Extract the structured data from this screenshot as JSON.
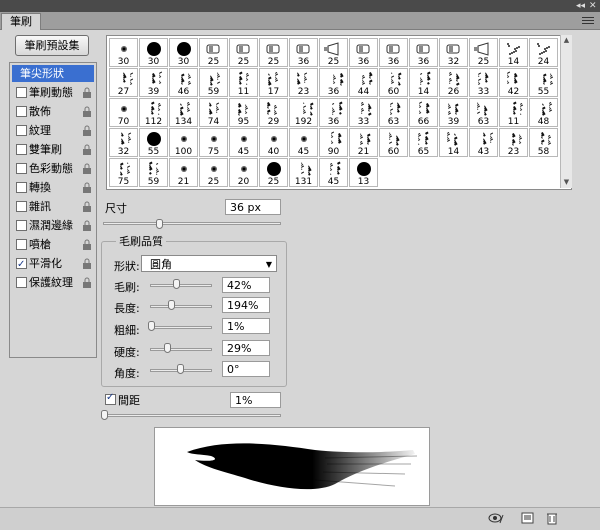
{
  "window": {
    "collapse_label": "◂◂",
    "close_label": "✕"
  },
  "panel": {
    "tab_title": "筆刷",
    "menu_icon": "panel-menu-icon"
  },
  "presets_button": "筆刷預設集",
  "left_items": [
    {
      "label": "筆尖形狀",
      "selected": true,
      "checked": false,
      "lock": false
    },
    {
      "label": "筆刷動態",
      "checked": false,
      "lock": true
    },
    {
      "label": "散佈",
      "checked": false,
      "lock": true
    },
    {
      "label": "紋理",
      "checked": false,
      "lock": true
    },
    {
      "label": "雙筆刷",
      "checked": false,
      "lock": true
    },
    {
      "label": "色彩動態",
      "checked": false,
      "lock": true
    },
    {
      "label": "轉換",
      "checked": false,
      "lock": true
    },
    {
      "label": "雜訊",
      "checked": false,
      "lock": true
    },
    {
      "label": "濕潤邊緣",
      "checked": false,
      "lock": true
    },
    {
      "label": "噴槍",
      "checked": false,
      "lock": true
    },
    {
      "label": "平滑化",
      "checked": true,
      "lock": true
    },
    {
      "label": "保護紋理",
      "checked": false,
      "lock": true
    }
  ],
  "brush_rows": [
    [
      "30",
      "30",
      "30",
      "25",
      "25",
      "25",
      "36",
      "25",
      "36",
      "36",
      "36",
      "32",
      "25",
      "14",
      "24"
    ],
    [
      "27",
      "39",
      "46",
      "59",
      "11",
      "17",
      "23",
      "36",
      "44",
      "60",
      "14",
      "26",
      "33",
      "42",
      "55"
    ],
    [
      "70",
      "112",
      "134",
      "74",
      "95",
      "29",
      "192",
      "36",
      "33",
      "63",
      "66",
      "39",
      "63",
      "11",
      "48"
    ],
    [
      "32",
      "55",
      "100",
      "75",
      "45",
      "40",
      "45",
      "90",
      "21",
      "60",
      "65",
      "14",
      "43",
      "23",
      "58"
    ],
    [
      "75",
      "59",
      "21",
      "25",
      "20",
      "25",
      "131",
      "45",
      "13"
    ]
  ],
  "size": {
    "label": "尺寸",
    "value": "36 px"
  },
  "tip_quality": {
    "title": "毛刷品質",
    "shape_label": "形狀:",
    "shape_value": "圓角",
    "rows": [
      {
        "label": "毛刷:",
        "value": "42%"
      },
      {
        "label": "長度:",
        "value": "194%"
      },
      {
        "label": "粗細:",
        "value": "1%"
      },
      {
        "label": "硬度:",
        "value": "29%"
      },
      {
        "label": "角度:",
        "value": "0°"
      }
    ]
  },
  "spacing": {
    "label": "間距",
    "checked": true,
    "value": "1%"
  },
  "colors": {
    "selection": "#3a6fd0",
    "panel_bg": "#d6d6d6"
  }
}
